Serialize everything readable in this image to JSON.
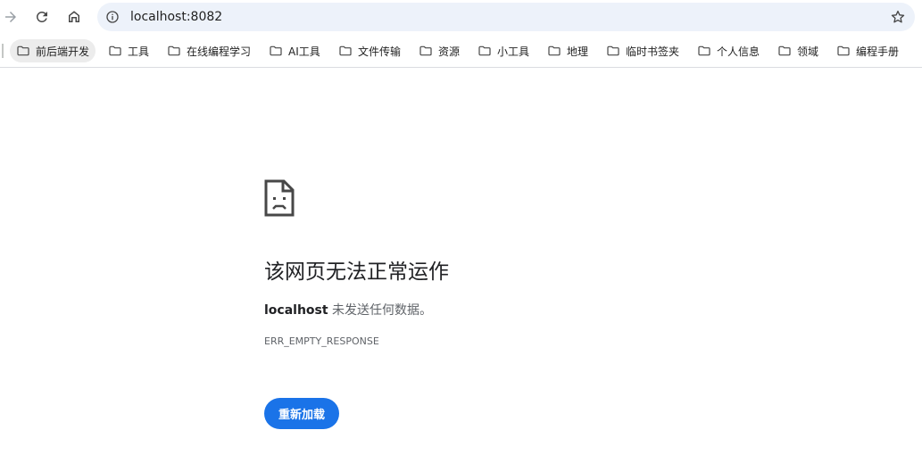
{
  "browser": {
    "omnibox": {
      "url": "localhost:8082"
    },
    "icons": {
      "back": "arrow-back-icon",
      "reload": "reload-icon",
      "home": "home-icon",
      "info": "info-icon",
      "star": "star-icon",
      "folder": "folder-icon"
    },
    "bookmarks": [
      {
        "label": "前后端开发"
      },
      {
        "label": "工具"
      },
      {
        "label": "在线编程学习"
      },
      {
        "label": "AI工具"
      },
      {
        "label": "文件传输"
      },
      {
        "label": "资源"
      },
      {
        "label": "小工具"
      },
      {
        "label": "地理"
      },
      {
        "label": "临时书签夹"
      },
      {
        "label": "个人信息"
      },
      {
        "label": "领域"
      },
      {
        "label": "编程手册"
      }
    ]
  },
  "error_page": {
    "icon": "sad-page-icon",
    "title": "该网页无法正常运作",
    "host": "localhost",
    "message": " 未发送任何数据。",
    "code": "ERR_EMPTY_RESPONSE",
    "reload_label": "重新加载"
  },
  "colors": {
    "accent": "#1a73e8",
    "omnibox_bg": "#edf2fa"
  }
}
